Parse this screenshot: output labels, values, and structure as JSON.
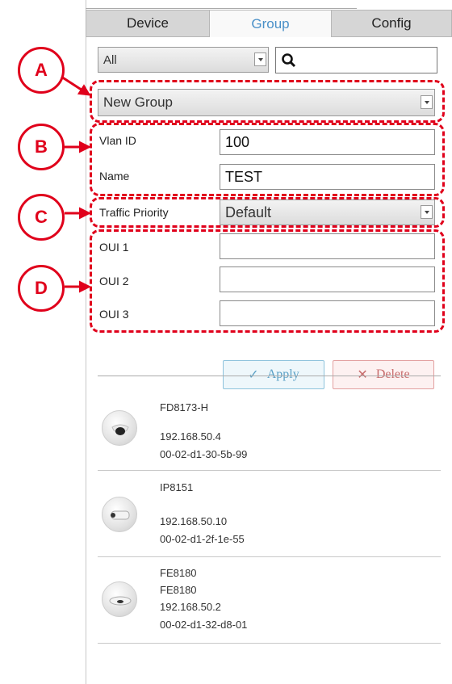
{
  "tabs": {
    "device": "Device",
    "group": "Group",
    "config": "Config"
  },
  "filter": {
    "selected": "All",
    "search_value": ""
  },
  "group_select": {
    "selected": "New Group"
  },
  "form": {
    "vlan_label": "Vlan ID",
    "vlan_value": "100",
    "name_label": "Name",
    "name_value": "TEST",
    "priority_label": "Traffic Priority",
    "priority_value": "Default",
    "oui1_label": "OUI 1",
    "oui1_value": "",
    "oui2_label": "OUI 2",
    "oui2_value": "",
    "oui3_label": "OUI 3",
    "oui3_value": ""
  },
  "buttons": {
    "apply": "Apply",
    "delete": "Delete"
  },
  "annotations": {
    "a": "A",
    "b": "B",
    "c": "C",
    "d": "D",
    "color": "#e0001b"
  },
  "devices": [
    {
      "model": "FD8173-H",
      "name": "",
      "ip": "192.168.50.4",
      "mac": "00-02-d1-30-5b-99",
      "icon": "dome-camera-icon"
    },
    {
      "model": "IP8151",
      "name": "",
      "ip": "192.168.50.10",
      "mac": "00-02-d1-2f-1e-55",
      "icon": "bullet-camera-icon"
    },
    {
      "model": "FE8180",
      "name": "FE8180",
      "ip": "192.168.50.2",
      "mac": "00-02-d1-32-d8-01",
      "icon": "fisheye-camera-icon"
    }
  ],
  "colors": {
    "tab_active_text": "#4a90c8",
    "apply": "#5aa0c6",
    "delete": "#c86c6c"
  }
}
